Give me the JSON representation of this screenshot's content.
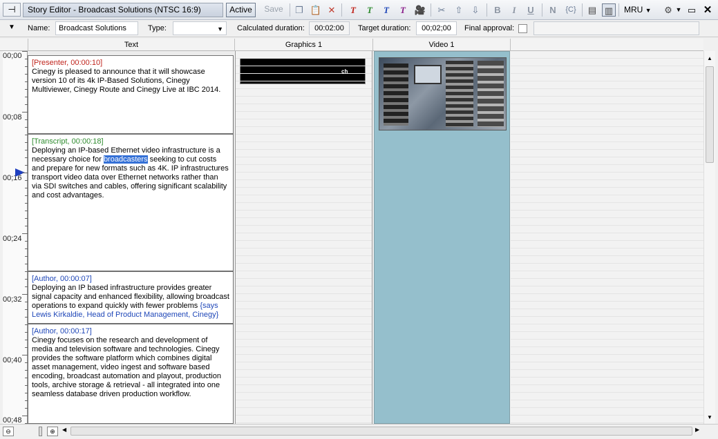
{
  "toolbar": {
    "title": "Story Editor - Broadcast Solutions (NTSC 16:9)",
    "active_label": "Active",
    "save_label": "Save",
    "mru_label": "MRU"
  },
  "fields": {
    "name_label": "Name:",
    "name_value": "Broadcast Solutions",
    "type_label": "Type:",
    "type_value": "",
    "calc_label": "Calculated duration:",
    "calc_value": "00:02:00",
    "target_label": "Target duration:",
    "target_value": "00;02;00",
    "approval_label": "Final approval:"
  },
  "columns": {
    "text": "Text",
    "graphics": "Graphics 1",
    "video": "Video 1"
  },
  "timeline": [
    "00;00",
    "00;08",
    "00;16",
    "00;24",
    "00;32",
    "00;40",
    "00;48"
  ],
  "blocks": [
    {
      "header": "[Presenter, 00:00:10]",
      "text": "Cinegy is pleased to announce that it will showcase version 10 of its 4k IP-Based Solutions, Cinegy Multiviewer, Cinegy Route and Cinegy Live at IBC 2014."
    },
    {
      "header": "[Transcript, 00:00:18]",
      "text_before": "Deploying an IP-based Ethernet video infrastructure is a necessary choice for ",
      "text_highlight": "broadcasters",
      "text_after": " seeking to cut costs and prepare for new formats such as 4K. IP infrastructures transport video data over Ethernet networks rather than via SDI switches and cables, offering significant scalability and cost advantages."
    },
    {
      "header": "[Author, 00:00:07]",
      "text": "Deploying an IP based infrastructure provides greater signal capacity and enhanced flexibility, allowing broadcast operations to expand quickly with fewer problems ",
      "text_note": "{says Lewis Kirkaldie, Head of Product Management, Cinegy}"
    },
    {
      "header": "[Author, 00:00:17]",
      "text": "Cinegy focuses on the research and development of media and television software and technologies. Cinegy provides the software platform which combines digital asset management, video ingest and software based encoding, broadcast automation and playout, production tools, archive storage & retrieval - all integrated into one seamless database driven production workflow."
    }
  ],
  "graphics_thumb_label": "ch",
  "colors": {
    "video_track": "#95bfcc",
    "highlight": "#3470d6",
    "presenter": "#c0241c",
    "transcript": "#2e8b2e",
    "author": "#1f47b8"
  }
}
